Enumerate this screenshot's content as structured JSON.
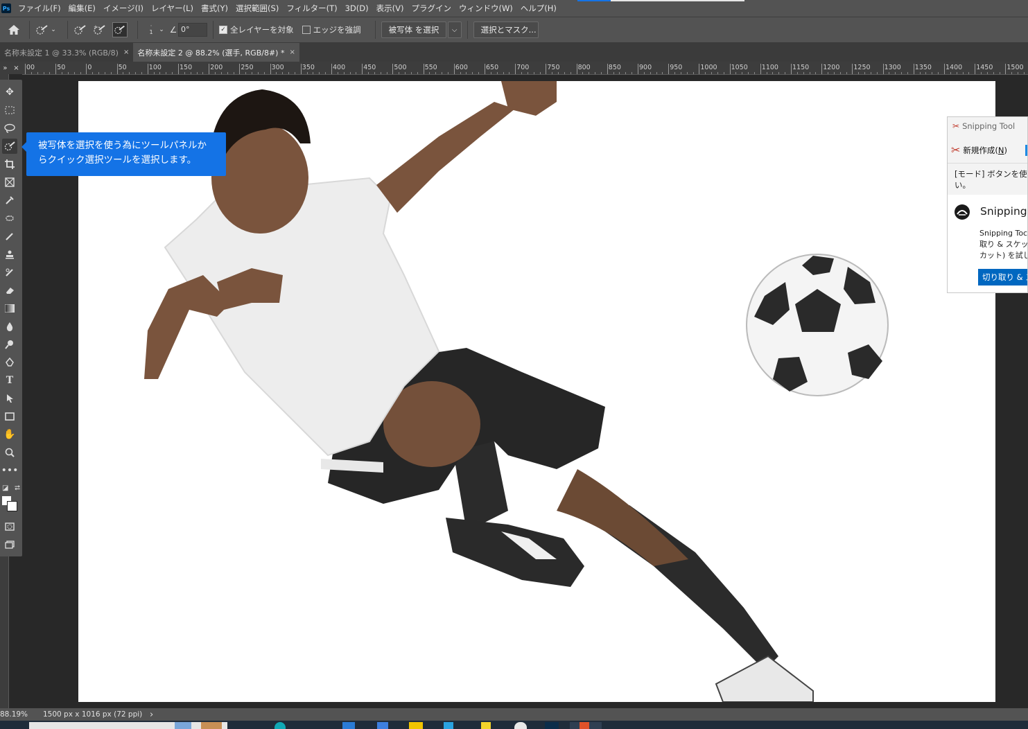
{
  "menubar": {
    "logo": "Ps",
    "items": [
      "ファイル(F)",
      "編集(E)",
      "イメージ(I)",
      "レイヤー(L)",
      "書式(Y)",
      "選択範囲(S)",
      "フィルター(T)",
      "3D(D)",
      "表示(V)",
      "プラグイン",
      "ウィンドウ(W)",
      "ヘルプ(H)"
    ]
  },
  "options": {
    "brush_size": "1",
    "angle": "0°",
    "sample_all_layers": "全レイヤーを対象",
    "sample_all_layers_checked": true,
    "enhance_edge": "エッジを強調",
    "enhance_edge_checked": false,
    "select_subject": "被写体 を選択",
    "select_and_mask": "選択とマスク..."
  },
  "tabs": [
    {
      "label": "名称未設定 1 @ 33.3% (RGB/8)",
      "active": false
    },
    {
      "label": "名称未設定 2 @ 88.2% (選手, RGB/8#) *",
      "active": true
    }
  ],
  "ruler": {
    "corner_left": "»",
    "corner_right": "×",
    "ticks": [
      "00",
      "50",
      "0",
      "50",
      "100",
      "150",
      "200",
      "250",
      "300",
      "350",
      "400",
      "450",
      "500",
      "550",
      "600",
      "650",
      "700",
      "750",
      "800",
      "850",
      "900",
      "950",
      "1000",
      "1050",
      "1100",
      "1150",
      "1200",
      "1250",
      "1300",
      "1350",
      "1400",
      "1450",
      "1500"
    ]
  },
  "tooltip": {
    "line1": "被写体を選択を使う為にツールパネルか",
    "line2": "らクイック選択ツールを選択します。"
  },
  "snipping": {
    "title": "Snipping Tool",
    "new_label": "新規作成(",
    "new_key": "N",
    "new_suffix": ")",
    "mode_desc": "[モード] ボタンを使用し\nい。",
    "promo_title": "Snipping",
    "promo_text": "Snipping Toc\n取り & スケッチ\nカット) を試して",
    "promo_button": "切り取り & ス"
  },
  "status": {
    "zoom": "88.19%",
    "doc_info": "1500 px x 1016 px (72 ppi)",
    "arrow": "›"
  },
  "colors": {
    "accent": "#1473e6",
    "panel": "#535353",
    "workspace": "#282828",
    "foreground": "#ffffff",
    "background": "#ffffff"
  },
  "icons": {
    "home": "home-icon",
    "tools": [
      "move-icon",
      "marquee-icon",
      "lasso-icon",
      "quick-select-icon",
      "crop-icon",
      "frame-icon",
      "eyedropper-icon",
      "healing-icon",
      "brush-icon",
      "stamp-icon",
      "history-brush-icon",
      "eraser-icon",
      "gradient-icon",
      "blur-icon",
      "dodge-icon",
      "pen-icon",
      "type-icon",
      "path-select-icon",
      "rectangle-icon",
      "hand-icon",
      "zoom-icon",
      "more-icon"
    ]
  }
}
